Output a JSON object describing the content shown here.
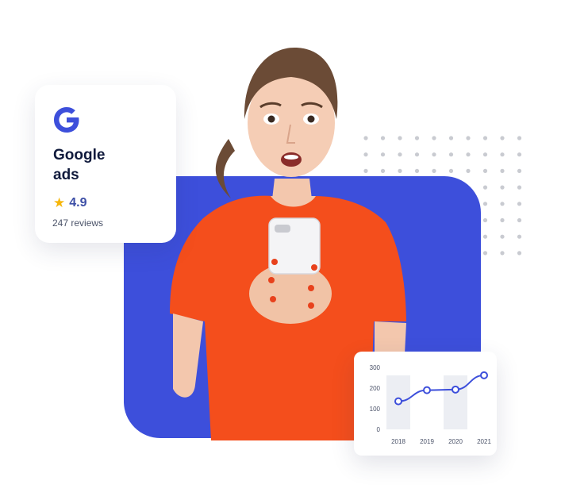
{
  "colors": {
    "accent_blue": "#3d4fdb",
    "shirt_orange": "#f44e1c",
    "star_yellow": "#f6b60a",
    "dot_gray": "#c9cbd1"
  },
  "google_card": {
    "logo_icon": "google-g-icon",
    "brand_line1": "Google",
    "brand_line2": "ads",
    "star_icon": "star-icon",
    "star_glyph": "★",
    "rating": "4.9",
    "reviews": "247 reviews"
  },
  "chart_data": {
    "type": "line",
    "categories": [
      "2018",
      "2019",
      "2020",
      "2021"
    ],
    "x_tick_labels": [
      "2018",
      "2019",
      "2020",
      "2021"
    ],
    "y_tick_labels": [
      "300",
      "200",
      "100",
      "0"
    ],
    "ylim": [
      0,
      300
    ],
    "values": [
      136,
      190,
      193,
      262
    ],
    "highlight_bands": [
      "2018",
      "2020"
    ],
    "title": "",
    "xlabel": "",
    "ylabel": "",
    "grid": false
  }
}
